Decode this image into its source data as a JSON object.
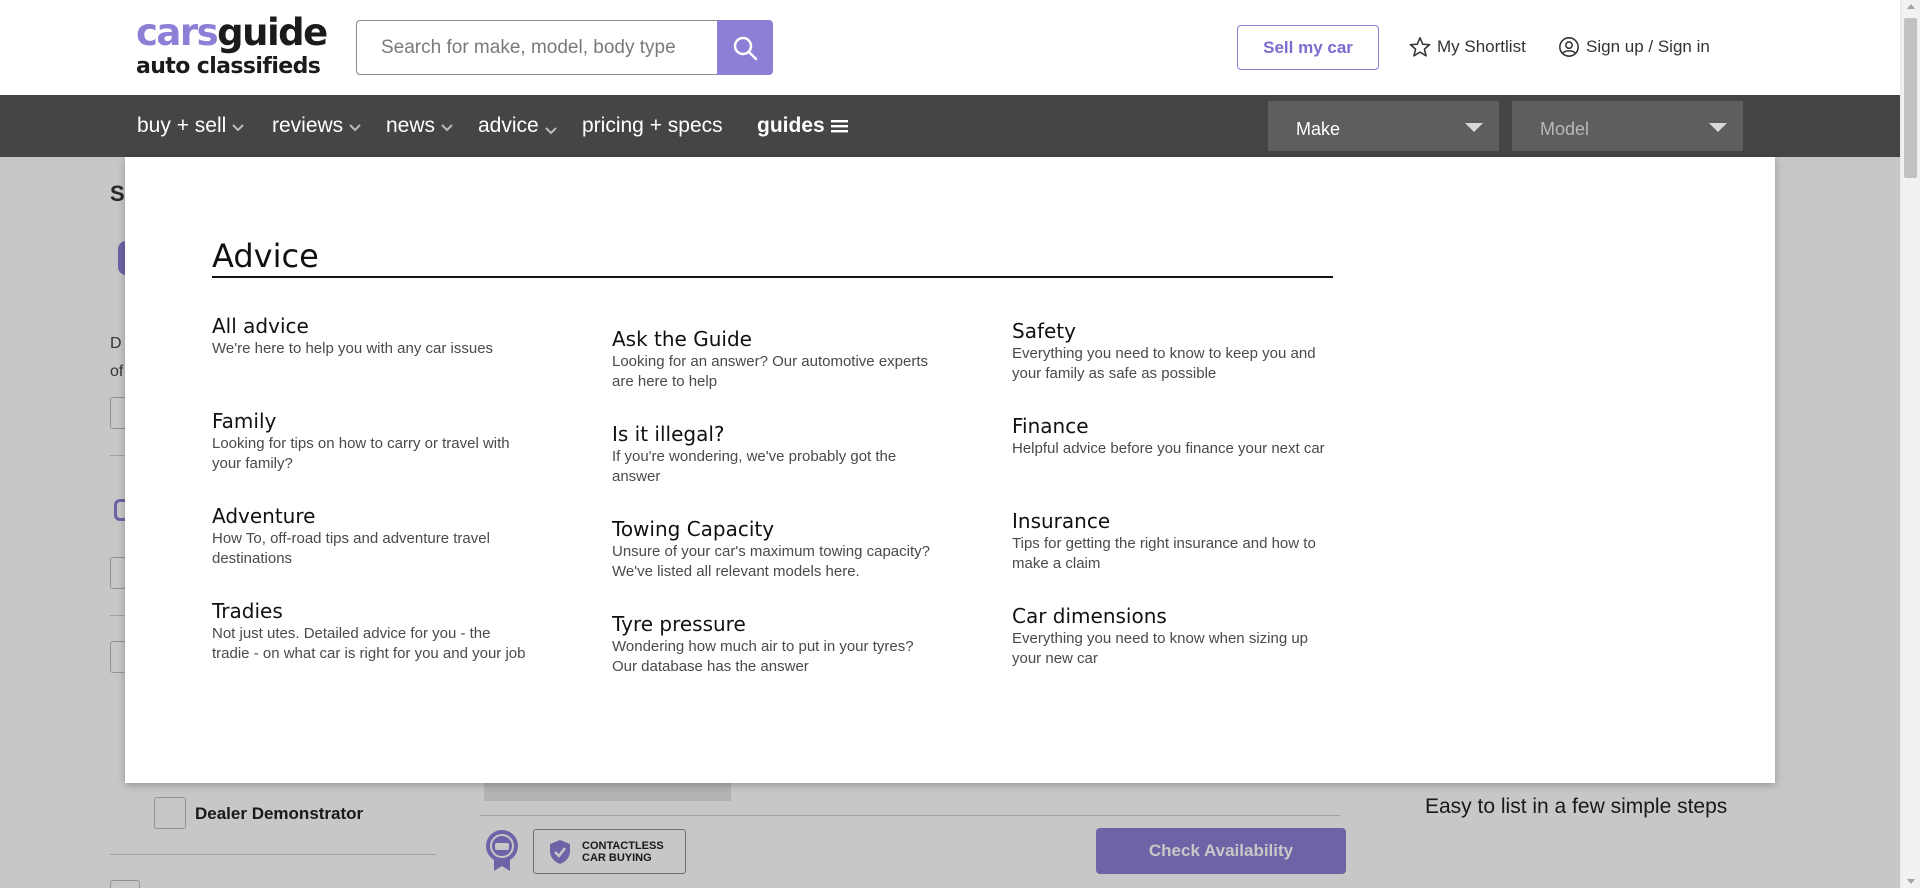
{
  "header": {
    "logo_main_a": "cars",
    "logo_main_b": "guide",
    "logo_sub": "auto classifieds",
    "search_placeholder": "Search for make, model, body type",
    "sell_label": "Sell my car",
    "shortlist_label": "My Shortlist",
    "signin_label": "Sign up / Sign in",
    "accent": "#8e7fd6"
  },
  "nav": {
    "items": [
      {
        "label": "buy + sell"
      },
      {
        "label": "reviews"
      },
      {
        "label": "news"
      },
      {
        "label": "advice"
      },
      {
        "label": "pricing + specs"
      },
      {
        "label": "guides"
      }
    ],
    "make_label": "Make",
    "model_label": "Model"
  },
  "menu": {
    "title": "Advice",
    "columns": [
      [
        {
          "title": "All advice",
          "desc": "We're here to help you with any car issues"
        },
        {
          "title": "Family",
          "desc": "Looking for tips on how to carry or travel with your family?"
        },
        {
          "title": "Adventure",
          "desc": "How To, off-road tips and adventure travel destinations"
        },
        {
          "title": "Tradies",
          "desc": "Not just utes. Detailed advice for you - the tradie - on what car is right for you and your job"
        }
      ],
      [
        {
          "title": "Ask the Guide",
          "desc": "Looking for an answer? Our automotive experts are here to help"
        },
        {
          "title": "Is it illegal?",
          "desc": "If you're wondering, we've probably got the answer"
        },
        {
          "title": "Towing Capacity",
          "desc": "Unsure of your car's maximum towing capacity? We've listed all relevant models here."
        },
        {
          "title": "Tyre pressure",
          "desc": "Wondering how much air to put in your tyres? Our database has the answer"
        }
      ],
      [
        {
          "title": "Safety",
          "desc": "Everything you need to know to keep you and your family as safe as possible"
        },
        {
          "title": "Finance",
          "desc": "Helpful advice before you finance your next car"
        },
        {
          "title": "Insurance",
          "desc": "Tips for getting the right insurance and how to make a claim"
        },
        {
          "title": "Car dimensions",
          "desc": "Everything you need to know when sizing up your new car"
        }
      ]
    ]
  },
  "background": {
    "left_heading_fragment": "S",
    "left_text_fragment_1": "D",
    "left_text_fragment_2": "of",
    "dealer_demo_label": "Dealer Demonstrator",
    "contactless_line1": "CONTACTLESS",
    "contactless_line2": "CAR BUYING",
    "check_label": "Check Availability",
    "easy_text": "Easy to list in a few simple steps"
  }
}
